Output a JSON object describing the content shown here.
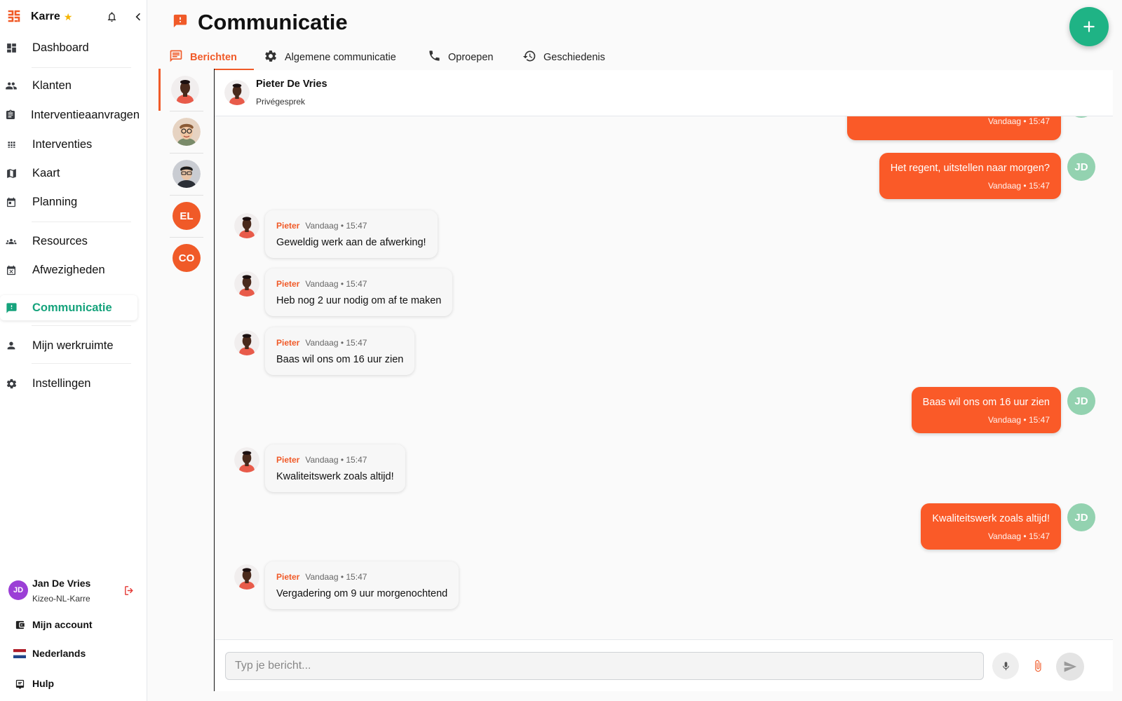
{
  "colors": {
    "accent": "#f05a28",
    "active_nav": "#16a37c",
    "fab": "#1fb385",
    "outgoing_bubble": "#fa5a28",
    "self_avatar": "#93d2b0",
    "user_avatar": "#9b3fd6"
  },
  "sidebar": {
    "brand": "Karre",
    "items": [
      {
        "label": "Dashboard",
        "icon": "dashboard-icon"
      },
      {
        "label": "Klanten",
        "icon": "people-icon"
      },
      {
        "label": "Interventieaanvragen",
        "icon": "clipboard-icon"
      },
      {
        "label": "Interventies",
        "icon": "grid-icon"
      },
      {
        "label": "Kaart",
        "icon": "map-icon"
      },
      {
        "label": "Planning",
        "icon": "calendar-icon"
      },
      {
        "label": "Resources",
        "icon": "groups-icon"
      },
      {
        "label": "Afwezigheden",
        "icon": "calendar-x-icon"
      },
      {
        "label": "Communicatie",
        "icon": "chat-alert-icon"
      },
      {
        "label": "Mijn werkruimte",
        "icon": "person-icon"
      },
      {
        "label": "Instellingen",
        "icon": "gear-icon"
      }
    ],
    "user": {
      "initials": "JD",
      "name": "Jan De Vries",
      "org": "Kizeo-NL-Karre"
    },
    "bottom_links": [
      {
        "label": "Mijn account",
        "icon": "wallet-icon"
      },
      {
        "label": "Nederlands",
        "icon": "flag-nl-icon"
      },
      {
        "label": "Hulp",
        "icon": "help-icon"
      }
    ]
  },
  "header": {
    "title": "Communicatie"
  },
  "tabs": [
    {
      "label": "Berichten",
      "icon": "message-icon"
    },
    {
      "label": "Algemene communicatie",
      "icon": "gear-icon"
    },
    {
      "label": "Oproepen",
      "icon": "phone-icon"
    },
    {
      "label": "Geschiedenis",
      "icon": "history-icon"
    }
  ],
  "conversations": [
    {
      "type": "photo"
    },
    {
      "type": "photo"
    },
    {
      "type": "photo"
    },
    {
      "type": "initials",
      "initials": "EL"
    },
    {
      "type": "initials",
      "initials": "CO"
    }
  ],
  "chat": {
    "name": "Pieter De Vries",
    "subtitle": "Privégesprek",
    "self_initials": "JD",
    "messages": [
      {
        "direction": "out",
        "text": "",
        "meta": "Vandaag • 15:47"
      },
      {
        "direction": "out",
        "text": "Het regent, uitstellen naar morgen?",
        "meta": "Vandaag • 15:47"
      },
      {
        "direction": "in",
        "sender": "Pieter",
        "meta": "Vandaag • 15:47",
        "text": "Geweldig werk aan de afwerking!"
      },
      {
        "direction": "in",
        "sender": "Pieter",
        "meta": "Vandaag • 15:47",
        "text": "Heb nog 2 uur nodig om af te maken"
      },
      {
        "direction": "in",
        "sender": "Pieter",
        "meta": "Vandaag • 15:47",
        "text": "Baas wil ons om 16 uur zien"
      },
      {
        "direction": "out",
        "text": "Baas wil ons om 16 uur zien",
        "meta": "Vandaag • 15:47"
      },
      {
        "direction": "in",
        "sender": "Pieter",
        "meta": "Vandaag • 15:47",
        "text": "Kwaliteitswerk zoals altijd!"
      },
      {
        "direction": "out",
        "text": "Kwaliteitswerk zoals altijd!",
        "meta": "Vandaag • 15:47"
      },
      {
        "direction": "in",
        "sender": "Pieter",
        "meta": "Vandaag • 15:47",
        "text": "Vergadering om 9 uur morgenochtend"
      }
    ]
  },
  "composer": {
    "placeholder": "Typ je bericht..."
  }
}
